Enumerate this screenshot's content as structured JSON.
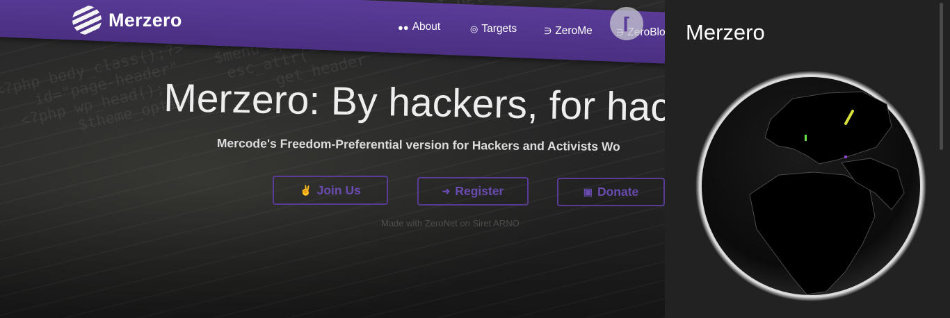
{
  "site": {
    "logo_text": "Merzero",
    "nav": [
      {
        "label": "About",
        "icon": "users-icon"
      },
      {
        "label": "Targets",
        "icon": "target-icon"
      },
      {
        "label": "ZeroMe",
        "icon": "rss-icon"
      },
      {
        "label": "ZeroBlo",
        "icon": "rss-icon"
      }
    ],
    "hero_title": "Merzero: By hackers, for hac",
    "hero_subtitle": "Mercode's Freedom-Preferential version for Hackers and Activists Wo",
    "buttons": [
      {
        "label": "Join Us",
        "icon": "handshake-icon"
      },
      {
        "label": "Register",
        "icon": "sign-in-icon"
      },
      {
        "label": "Donate",
        "icon": "money-icon"
      }
    ],
    "made_with": "Made with ZeroNet on Siret ARNO"
  },
  "panel": {
    "title": "Merzero"
  },
  "colors": {
    "nav_purple": "#4a2f82",
    "button_purple": "#5a3c98",
    "panel_bg": "#222222",
    "globe_markers": [
      "#6ee04c",
      "#d9e03a",
      "#8a44c8"
    ]
  }
}
